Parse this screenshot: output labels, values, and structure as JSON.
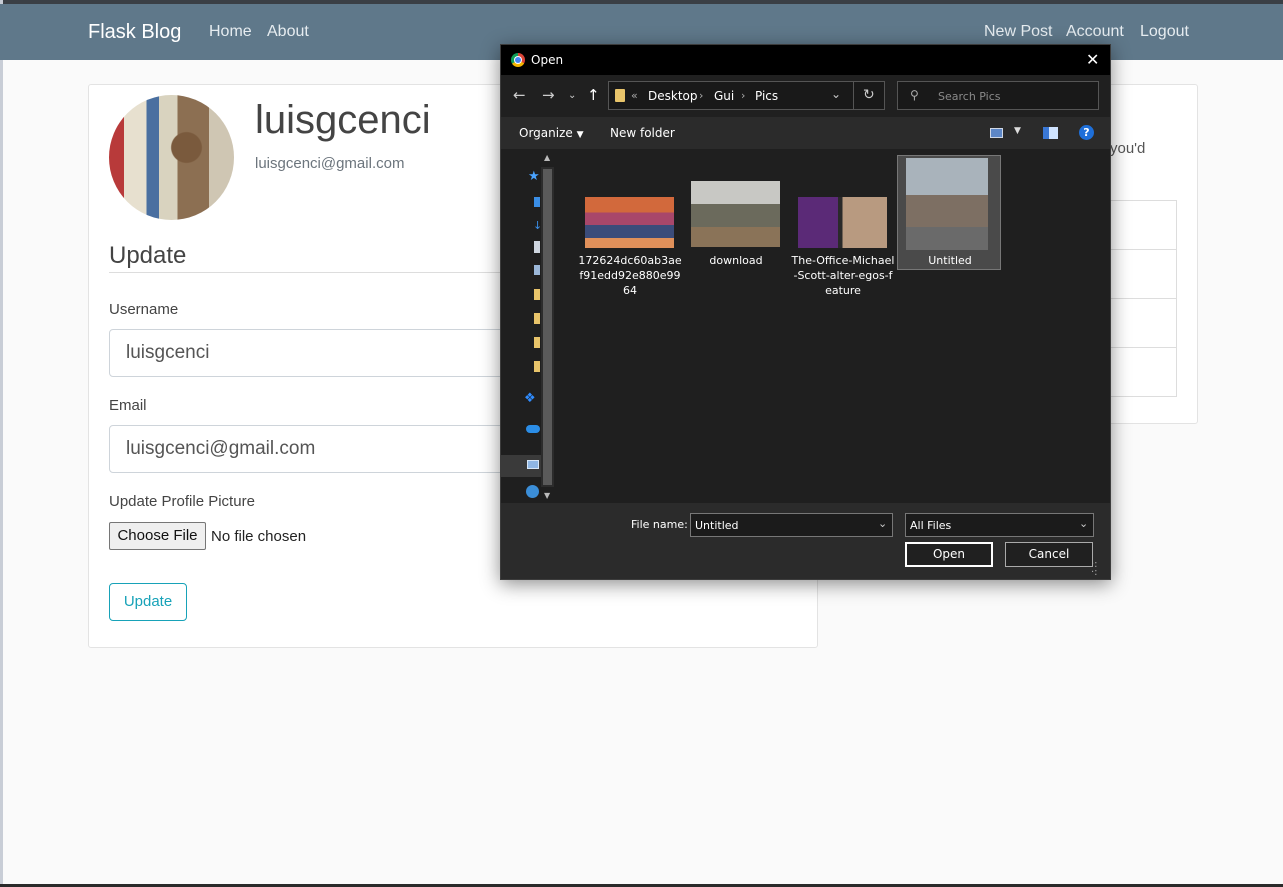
{
  "navbar": {
    "brand": "Flask Blog",
    "left_links": [
      "Home",
      "About"
    ],
    "right_links": [
      "New Post",
      "Account",
      "Logout"
    ]
  },
  "profile": {
    "username": "luisgcenci",
    "email": "luisgcenci@gmail.com"
  },
  "form": {
    "legend": "Update",
    "username_label": "Username",
    "username_value": "luisgcenci",
    "email_label": "Email",
    "email_value": "luisgcenci@gmail.com",
    "picture_label": "Update Profile Picture",
    "choose_file_label": "Choose File",
    "no_file_text": "No file chosen",
    "submit_label": "Update"
  },
  "sidebar": {
    "partial_text": "you'd"
  },
  "dialog": {
    "title": "Open",
    "breadcrumb": [
      "Desktop",
      "Gui",
      "Pics"
    ],
    "breadcrumb_prefix": "«",
    "search_placeholder": "Search Pics",
    "organize_label": "Organize",
    "new_folder_label": "New folder",
    "help_label": "?",
    "files": [
      {
        "name": "172624dc60ab3aef91edd92e880e9964",
        "selected": false
      },
      {
        "name": "download",
        "selected": false
      },
      {
        "name": "The-Office-Michael-Scott-alter-egos-feature",
        "selected": false
      },
      {
        "name": "Untitled",
        "selected": true
      }
    ],
    "file_name_label": "File name:",
    "file_name_value": "Untitled",
    "file_type_value": "All Files",
    "open_label": "Open",
    "cancel_label": "Cancel"
  },
  "colors": {
    "navbar_bg": "#5f788a",
    "accent": "#17a2b8",
    "dialog_bg": "#202020"
  }
}
